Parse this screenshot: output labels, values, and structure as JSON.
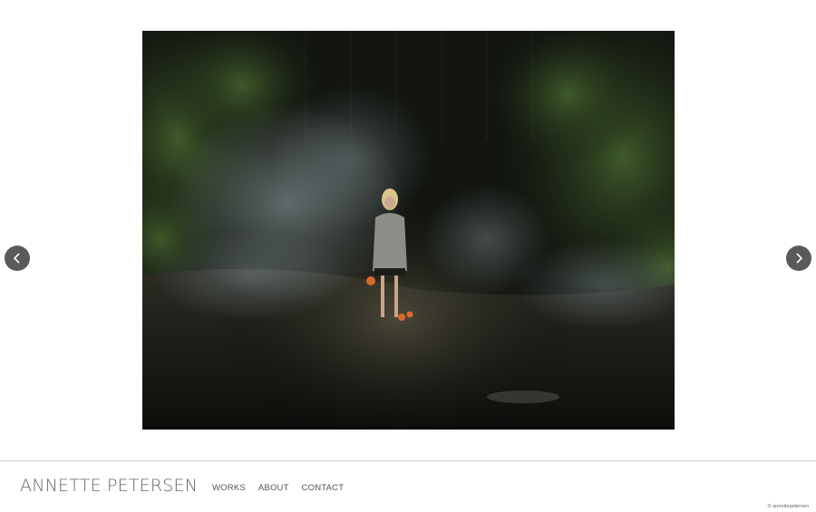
{
  "site": {
    "title": "ANNETTE PETERSEN",
    "copyright": "© annettepetersen"
  },
  "nav": {
    "items": [
      {
        "label": "WORKS"
      },
      {
        "label": "ABOUT"
      },
      {
        "label": "CONTACT"
      }
    ]
  },
  "slideshow": {
    "prev_icon": "chevron-left-icon",
    "next_icon": "chevron-right-icon",
    "arrow_bg": "#5a5a5a"
  },
  "colors": {
    "background": "#ffffff",
    "text": "#555555",
    "rule": "#cfcfcf"
  }
}
